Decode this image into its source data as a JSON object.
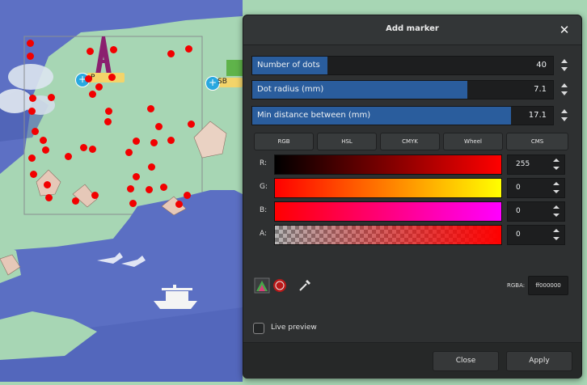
{
  "map": {
    "marker_labels": [
      "P",
      "SB"
    ]
  },
  "dialog": {
    "title": "Add marker",
    "close_glyph": "✕",
    "sliders": [
      {
        "label": "Number of dots",
        "value": "40",
        "fill": 0.25
      },
      {
        "label": "Dot radius (mm)",
        "value": "7.1",
        "fill": 0.71
      },
      {
        "label": "Min distance between (mm)",
        "value": "17.1",
        "fill": 0.86
      }
    ],
    "tabs": [
      "RGB",
      "HSL",
      "CMYK",
      "Wheel",
      "CMS"
    ],
    "channels": [
      {
        "label": "R:",
        "value": "255"
      },
      {
        "label": "G:",
        "value": "0"
      },
      {
        "label": "B:",
        "value": "0"
      },
      {
        "label": "A:",
        "value": "0"
      }
    ],
    "rgba_label": "RGBA:",
    "rgba_value": "ff000000",
    "live_preview_label": "Live preview",
    "close_button": "Close",
    "apply_button": "Apply"
  },
  "colors": {
    "accent": "#2a5d9d",
    "marker": "#f20000",
    "map_land": "#a7d6b4",
    "map_water": "#5b6fc3",
    "dialog_bg": "#2e3031"
  }
}
